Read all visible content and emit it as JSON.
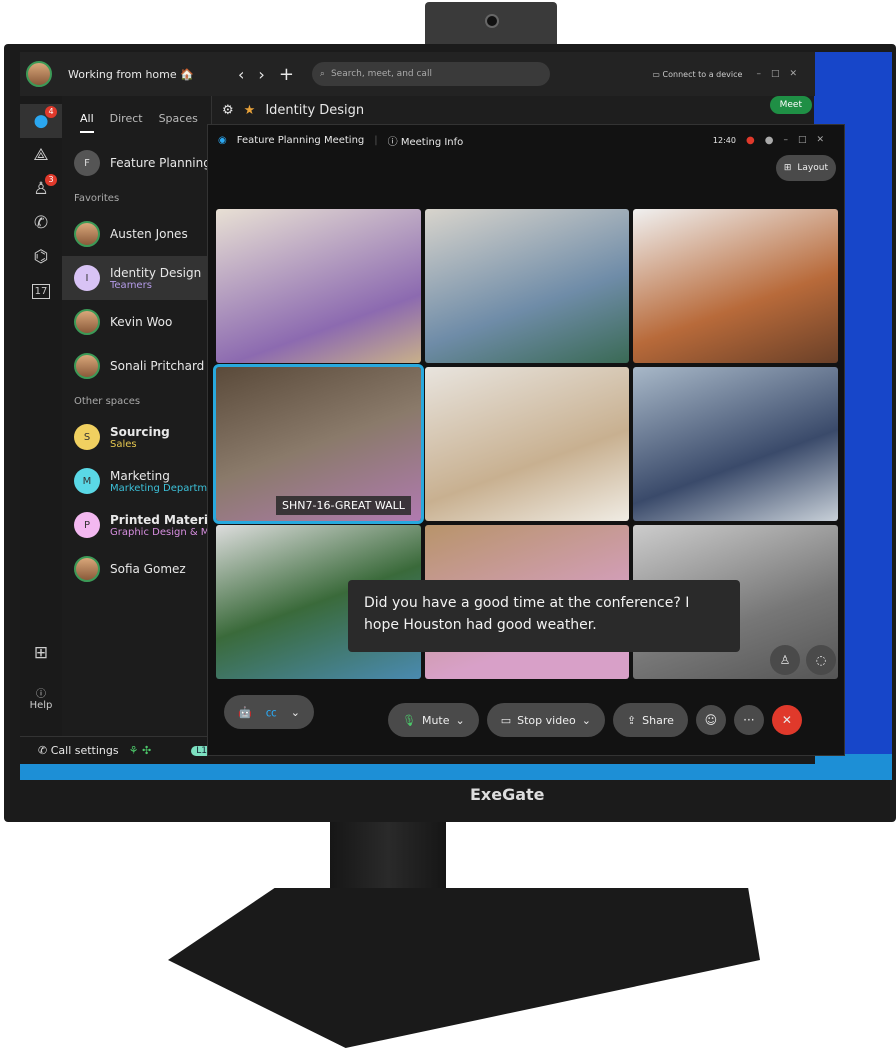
{
  "top": {
    "status": "Working from home 🏠",
    "search_placeholder": "Search, meet, and call",
    "connect": "Connect to a device"
  },
  "rail": {
    "messages_badge": "4",
    "teams_badge": "3",
    "calendar_day": "17",
    "help": "Help"
  },
  "list": {
    "tabs": [
      "All",
      "Direct",
      "Spaces"
    ],
    "pinned": {
      "initial": "F",
      "name": "Feature Planning Meeting"
    },
    "favorites_label": "Favorites",
    "favorites": [
      {
        "name": "Austen Jones"
      },
      {
        "initial": "I",
        "name": "Identity Design",
        "sub": "Teamers"
      },
      {
        "name": "Kevin Woo"
      },
      {
        "name": "Sonali Pritchard"
      }
    ],
    "other_label": "Other spaces",
    "other": [
      {
        "initial": "S",
        "name": "Sourcing",
        "sub": "Sales",
        "color": "#f0d060"
      },
      {
        "initial": "M",
        "name": "Marketing",
        "sub": "Marketing Department",
        "color": "#5ad8e6"
      },
      {
        "initial": "P",
        "name": "Printed Materials",
        "sub": "Graphic Design & Marketing",
        "color": "#f3b8f0"
      },
      {
        "name": "Sofia Gomez"
      }
    ]
  },
  "space": {
    "title": "Identity Design",
    "meet": "Meet"
  },
  "status": {
    "call_settings": "Call settings",
    "line": "L1"
  },
  "meeting": {
    "title": "Feature Planning Meeting",
    "info": "Meeting Info",
    "time": "12:40",
    "layout": "Layout",
    "tile_label": "SHN7-16-GREAT WALL",
    "caption": "Did you have a good time at the conference? I hope Houston had good weather.",
    "mute": "Mute",
    "stop_video": "Stop video",
    "share": "Share",
    "more": "···",
    "end": "✕"
  },
  "brand": "ExeGate",
  "colors": {
    "accent": "#28a9de",
    "end": "#e0392b",
    "meet": "#1f8f45",
    "desktop": "#1746c9"
  }
}
